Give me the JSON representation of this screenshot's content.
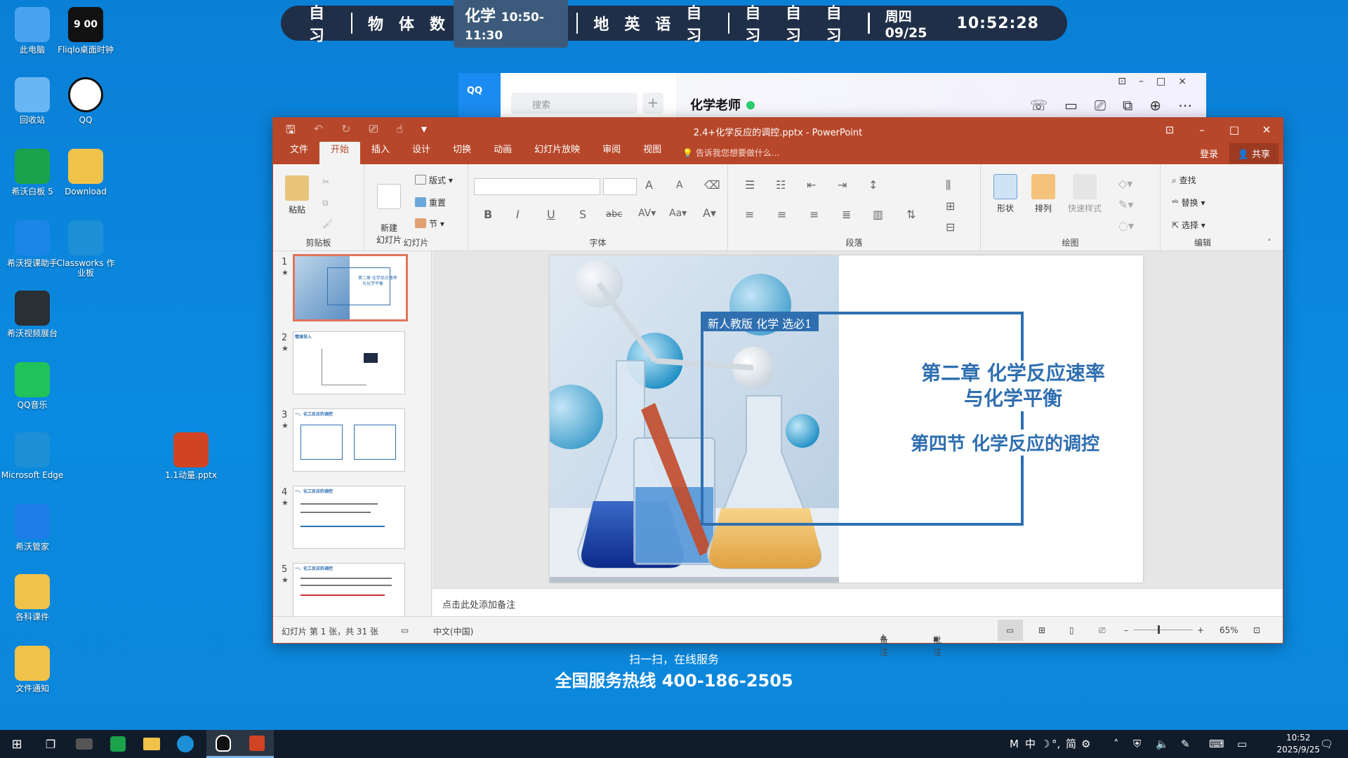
{
  "desktop": {
    "icons": [
      {
        "label": "此电脑",
        "icon": "computer-icon",
        "color": "#4aa3f0"
      },
      {
        "label": "回收站",
        "icon": "recycle-bin-icon",
        "color": "#6ab6f2"
      },
      {
        "label": "希沃白板 5",
        "icon": "seewo-whiteboard-icon",
        "color": "#1aa34a"
      },
      {
        "label": "希沃授课助手",
        "icon": "seewo-link-icon",
        "color": "#1b86e8"
      },
      {
        "label": "希沃视频展台",
        "icon": "seewo-camera-icon",
        "color": "#2a2f36"
      },
      {
        "label": "QQ音乐",
        "icon": "qq-music-icon",
        "color": "#20c25a"
      },
      {
        "label": "Microsoft Edge",
        "icon": "edge-icon",
        "color": "#1c8fd6"
      },
      {
        "label": "希沃管家",
        "icon": "seewo-guard-icon",
        "color": "#1e7ce8"
      },
      {
        "label": "各科课件",
        "icon": "folder-icon",
        "color": "#f0c24a"
      },
      {
        "label": "文件通知",
        "icon": "folder-warning-icon",
        "color": "#f0c24a"
      },
      {
        "label": "Fliqlo桌面时钟",
        "icon": "fliqlo-clock-icon",
        "color": "#111111",
        "glyph": "9 00"
      },
      {
        "label": "QQ",
        "icon": "qq-icon",
        "color": "#ffffff"
      },
      {
        "label": "Download",
        "icon": "download-folder-icon",
        "color": "#f0c24a"
      },
      {
        "label": "Classworks 作业板",
        "icon": "classworks-icon",
        "color": "#1c8fd6"
      },
      {
        "label": "1.1动量.pptx",
        "icon": "pptx-file-icon",
        "color": "#d04423"
      }
    ]
  },
  "schedule": {
    "groups": [
      [
        "自习"
      ],
      [
        "物",
        "体",
        "数"
      ],
      [
        "化学"
      ],
      [
        "地",
        "英",
        "语",
        "自习"
      ],
      [
        "自习",
        "自习",
        "自习"
      ]
    ],
    "current_time": "10:50-11:30",
    "date": "周四 09/25",
    "clock": "10:52:28"
  },
  "qq": {
    "brand": "QQ",
    "search_placeholder": "搜索",
    "plus": "+",
    "chat_title": "化学老师"
  },
  "ppt": {
    "window_title": "2.4+化学反应的调控.pptx - PowerPoint",
    "tabs": [
      "文件",
      "开始",
      "插入",
      "设计",
      "切换",
      "动画",
      "幻灯片放映",
      "审阅",
      "视图"
    ],
    "tell_me": "告诉我您想要做什么...",
    "login": "登录",
    "share": "共享",
    "ribbon": {
      "paste": "粘贴",
      "clipboard": "剪贴板",
      "new_slide": "新建\n幻灯片",
      "layout": "版式",
      "reset": "重置",
      "section": "节",
      "slides": "幻灯片",
      "font": "字体",
      "paragraph": "段落",
      "shape": "形状",
      "arrange": "排列",
      "quick_styles": "快速样式",
      "drawing": "绘图",
      "find": "查找",
      "replace": "替换",
      "select": "选择",
      "editing": "编辑",
      "bold": "B",
      "italic": "I",
      "underline": "U",
      "shadow": "S",
      "strike": "abc"
    },
    "slide": {
      "tag": "新人教版  化学  选必1",
      "title_line1": "第二章  化学反应速率",
      "title_line2": "与化学平衡",
      "subtitle": "第四节 化学反应的调控"
    },
    "thumbs": [
      {
        "num": "1",
        "caption_a": "第二章 化学反应速率",
        "caption_b": "与化学平衡"
      },
      {
        "num": "2",
        "caption_a": "情境导入"
      },
      {
        "num": "3",
        "caption_a": "一、化工反应的调控"
      },
      {
        "num": "4",
        "caption_a": "一、化工反应的调控"
      },
      {
        "num": "5",
        "caption_a": "一、化工反应的调控"
      }
    ],
    "notes_placeholder": "点击此处添加备注",
    "status": {
      "slide_info": "幻灯片 第 1 张，共 31 张",
      "language": "中文(中国)",
      "notes": "备注",
      "comments": "批注",
      "zoom": "65%"
    }
  },
  "footer": {
    "line1": "扫一扫，在线服务",
    "line2": "全国服务热线 400-186-2505"
  },
  "taskbar": {
    "ime": "中",
    "ime2": "简",
    "time": "10:52",
    "date": "2025/9/25"
  },
  "colors": {
    "ppt_accent": "#b7472a",
    "slide_blue": "#2f6fb0"
  }
}
